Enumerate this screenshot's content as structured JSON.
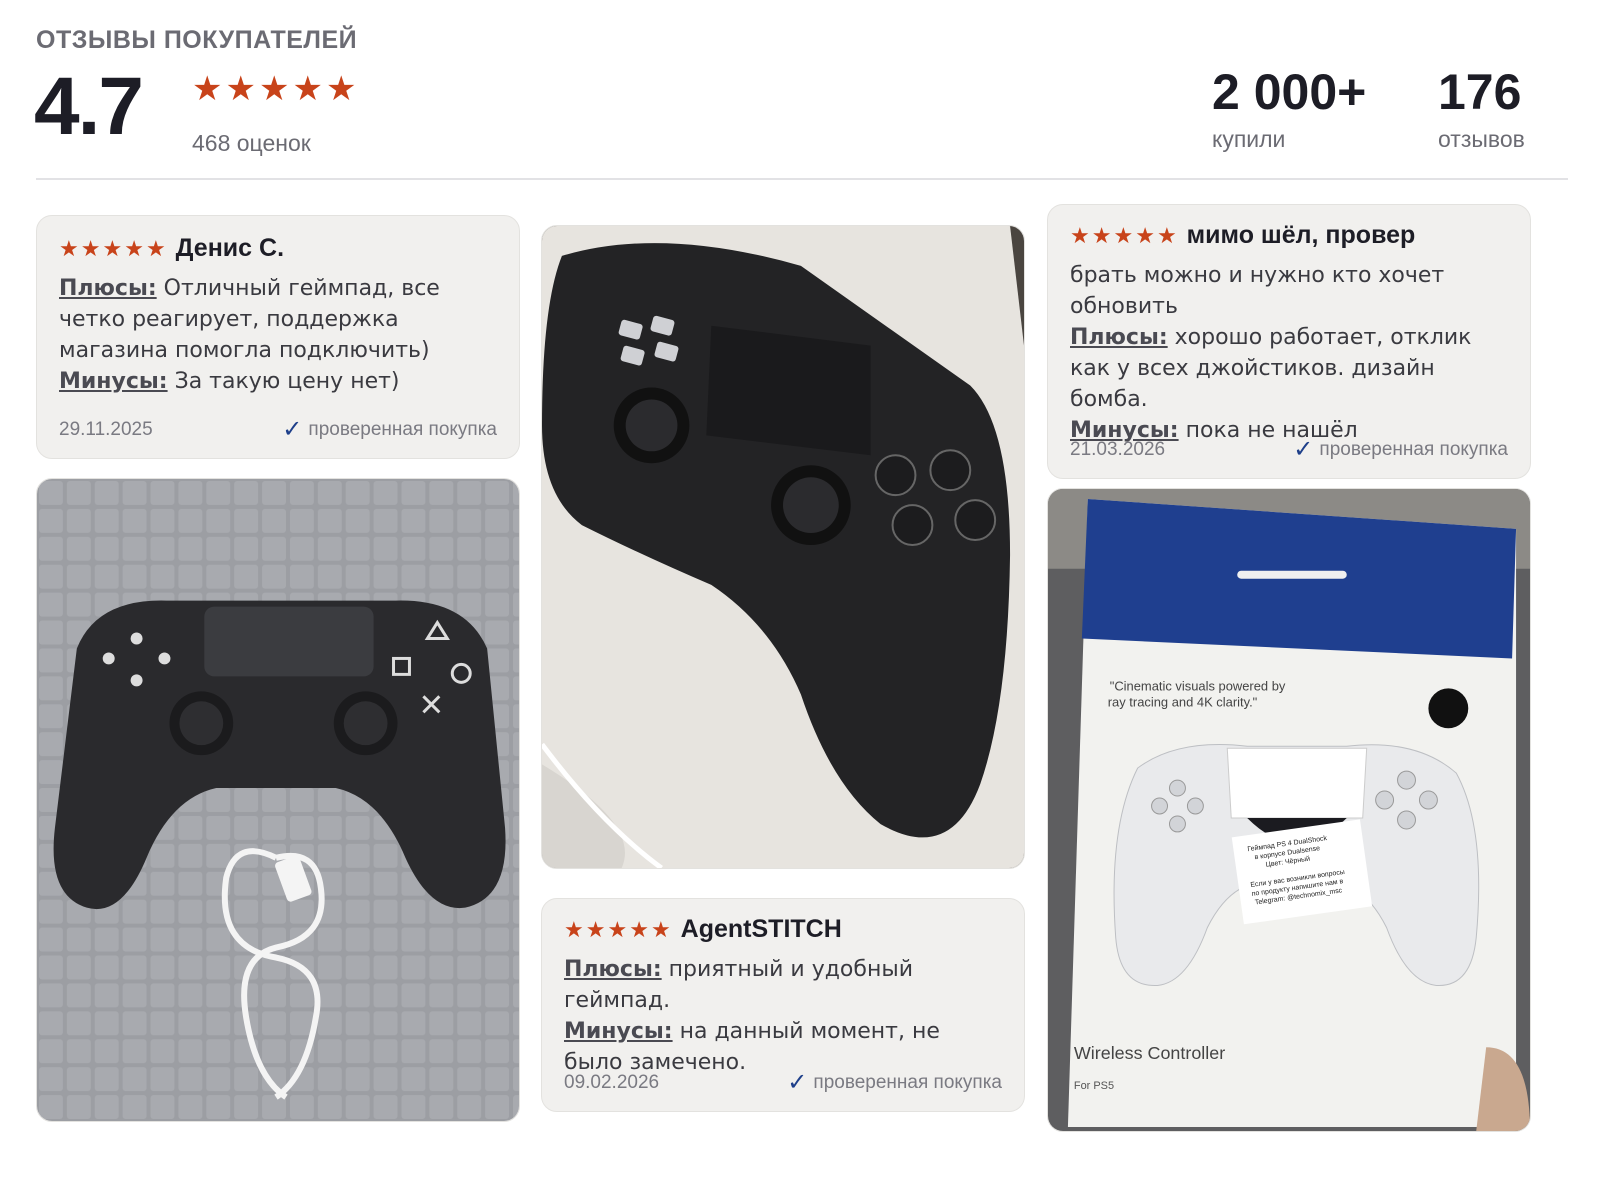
{
  "header": {
    "title": "ОТЗЫВЫ ПОКУПАТЕЛЕЙ",
    "rating": "4.7",
    "rating_stars": 5,
    "ratings_count": "468 оценок",
    "bought_num": "2 000+",
    "bought_label": "купили",
    "reviews_num": "176",
    "reviews_label": "отзывов"
  },
  "reviews": [
    {
      "stars": 5,
      "author": "Денис С.",
      "pros_label": "Плюсы:",
      "pros": "Отличный геймпад, все четко реагирует, поддержка магазина помогла подключить)",
      "cons_label": "Минусы:",
      "cons": "За такую цену нет)",
      "date": "29.11.2025",
      "verified": "проверенная покупка"
    },
    {
      "stars": 5,
      "author": "мимо шёл, провер",
      "intro": "брать можно и нужно кто хочет обновить",
      "pros_label": "Плюсы:",
      "pros": "хорошо работает, отклик как у всех джойстиков. дизайн бомба.",
      "cons_label": "Минусы:",
      "cons": "пока не нашёл",
      "date": "21.03.2026",
      "verified": "проверенная покупка"
    },
    {
      "stars": 5,
      "author": "AgentSTITCH",
      "pros_label": "Плюсы:",
      "pros": "приятный и удобный геймпад.",
      "cons_label": "Минусы:",
      "cons": "на данный момент, не было замечено.",
      "date": "09.02.2026",
      "verified": "проверенная покупка"
    }
  ],
  "photos": {
    "box_quote": "\"Cinematic visuals powered by ray tracing and 4K clarity.\"",
    "box_title": "Wireless Controller",
    "box_sub": "For PS5",
    "box_sticker_1": "Геймпад PS 4 DualShock",
    "box_sticker_2": "в корпусе Dualsense",
    "box_sticker_3": "Цвет: Чёрный",
    "box_sticker_4": "Если у вас возникли вопросы",
    "box_sticker_5": "по продукту напишите нам в",
    "box_sticker_6": "Telegram: @technomix_msc"
  },
  "colors": {
    "star": "#c8431a",
    "verified_check": "#1e3f8a",
    "card_bg": "#f1f0ee"
  }
}
